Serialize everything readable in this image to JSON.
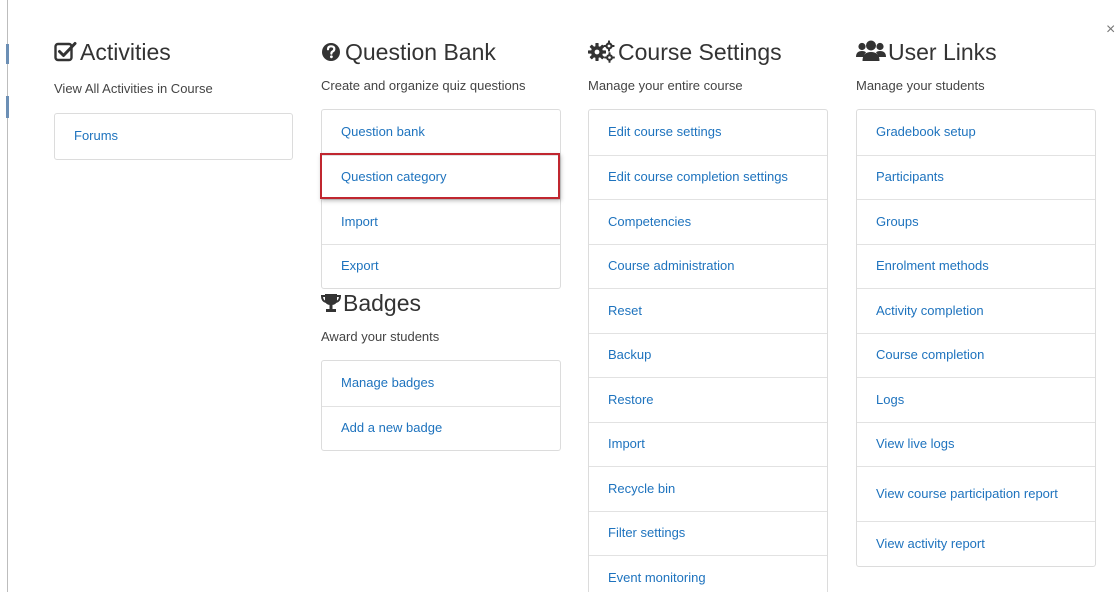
{
  "close": {
    "glyph": "×"
  },
  "activities": {
    "title": "Activities",
    "icon": "check-square-icon",
    "description": "View All Activities in Course",
    "links": [
      "Forums"
    ]
  },
  "question_bank": {
    "title": "Question Bank",
    "icon": "question-circle-icon",
    "description": "Create and organize quiz questions",
    "links": [
      "Question bank",
      "Question category",
      "Import",
      "Export"
    ],
    "highlighted_link": "Question category",
    "highlight_color": "#c0262f"
  },
  "badges": {
    "title": "Badges",
    "icon": "trophy-icon",
    "description": "Award your students",
    "links": [
      "Manage badges",
      "Add a new badge"
    ]
  },
  "course_settings": {
    "title": "Course Settings",
    "icon": "cogs-icon",
    "description": "Manage your entire course",
    "links": [
      "Edit course settings",
      "Edit course completion settings",
      "Competencies",
      "Course administration",
      "Reset",
      "Backup",
      "Restore",
      "Import",
      "Recycle bin",
      "Filter settings",
      "Event monitoring"
    ]
  },
  "user_links": {
    "title": "User Links",
    "icon": "users-icon",
    "description": "Manage your students",
    "links": [
      "Gradebook setup",
      "Participants",
      "Groups",
      "Enrolment methods",
      "Activity completion",
      "Course completion",
      "Logs",
      "View live logs",
      "View course participation report",
      "View activity report"
    ]
  },
  "colors": {
    "link": "#1e73be",
    "heading": "#333333",
    "border": "#dcdcdc"
  }
}
